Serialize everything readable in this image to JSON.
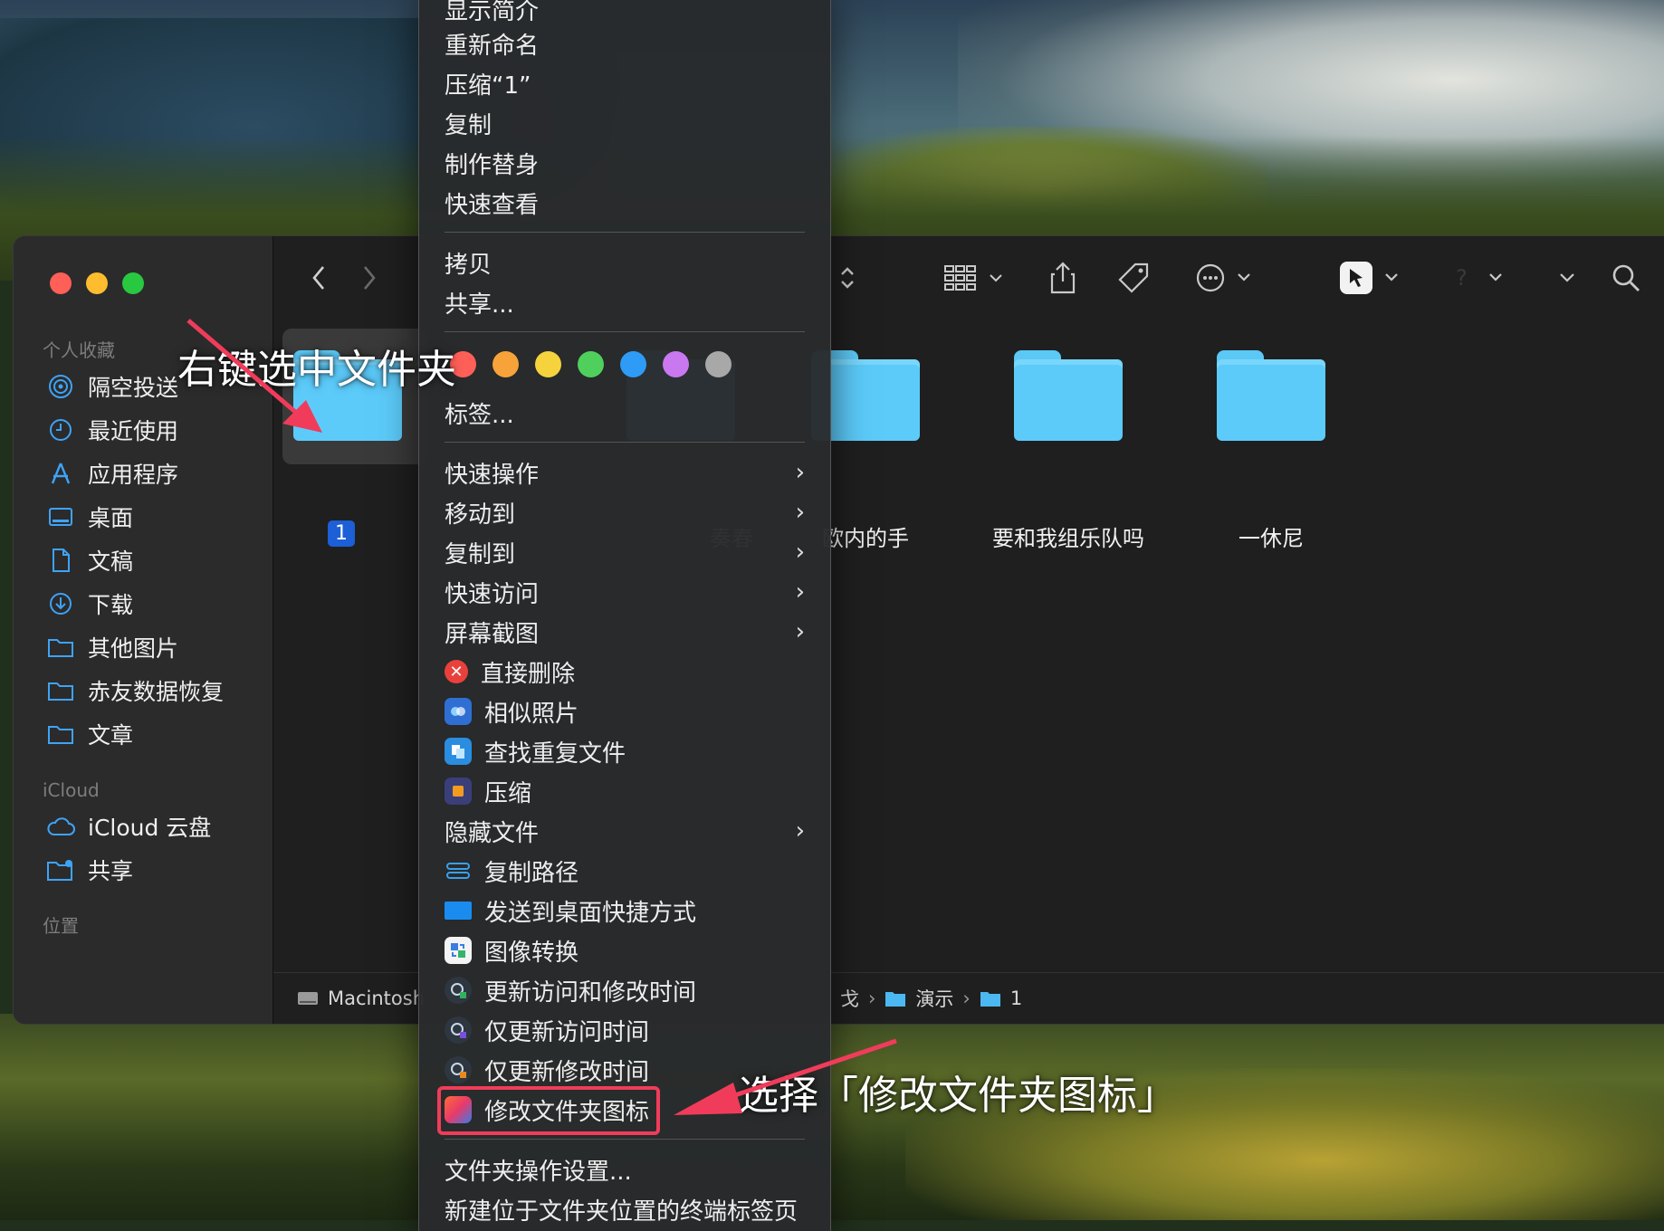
{
  "colors": {
    "accent_red": "#f03c5a",
    "folder_blue": "#5ccbfa",
    "selection_blue": "#1c5fd6"
  },
  "sidebar": {
    "favorites_heading": "个人收藏",
    "favorites": [
      {
        "label": "隔空投送",
        "icon": "airdrop-icon"
      },
      {
        "label": "最近使用",
        "icon": "clock-icon"
      },
      {
        "label": "应用程序",
        "icon": "applications-icon"
      },
      {
        "label": "桌面",
        "icon": "desktop-icon"
      },
      {
        "label": "文稿",
        "icon": "document-icon"
      },
      {
        "label": "下载",
        "icon": "download-icon"
      },
      {
        "label": "其他图片",
        "icon": "folder-icon"
      },
      {
        "label": "赤友数据恢复",
        "icon": "folder-icon"
      },
      {
        "label": "文章",
        "icon": "folder-icon"
      }
    ],
    "icloud_heading": "iCloud",
    "icloud": [
      {
        "label": "iCloud 云盘",
        "icon": "cloud-icon"
      },
      {
        "label": "共享",
        "icon": "shared-folder-icon"
      }
    ],
    "locations_heading": "位置"
  },
  "toolbar": {
    "back": "<",
    "forward": ">",
    "sort": "⌃⌄"
  },
  "folders": [
    {
      "label": "1",
      "selected": true
    },
    {
      "label": "奏春"
    },
    {
      "label": "欧内的手"
    },
    {
      "label": "要和我组乐队吗"
    },
    {
      "label": "一休尼"
    }
  ],
  "pathbar": {
    "disk": "Macintosh",
    "partial": "戈",
    "demo": "演示",
    "current": "1"
  },
  "menu": {
    "top_items": [
      "显示简介",
      "重新命名",
      "压缩“1”",
      "复制",
      "制作替身",
      "快速查看"
    ],
    "copy_items": [
      "拷贝",
      "共享..."
    ],
    "tag_colors": [
      "#fe5f57",
      "#f7a33a",
      "#f6d33c",
      "#4fd05c",
      "#2e9bf6",
      "#c978f0",
      "#a8a8a8"
    ],
    "tags_label": "标签...",
    "submenu_items": [
      "快速操作",
      "移动到",
      "复制到",
      "快速访问",
      "屏幕截图"
    ],
    "tool_items": [
      {
        "label": "直接删除",
        "icon": "delete-icon",
        "color": "#e8413c"
      },
      {
        "label": "相似照片",
        "icon": "photos-icon",
        "color": "#2f6fd3"
      },
      {
        "label": "查找重复文件",
        "icon": "duplicate-icon",
        "color": "#2a8de0"
      },
      {
        "label": "压缩",
        "icon": "compress-icon",
        "color": "#f29c1f"
      }
    ],
    "hidden_files": "隐藏文件",
    "tool_items_2": [
      {
        "label": "复制路径",
        "icon": "path-icon",
        "color": "#3aa0ef"
      },
      {
        "label": "发送到桌面快捷方式",
        "icon": "desktop-shortcut-icon",
        "color": "#1a8cf0"
      },
      {
        "label": "图像转换",
        "icon": "image-convert-icon",
        "color": "#3b7de0"
      },
      {
        "label": "更新访问和修改时间",
        "icon": "time-icon",
        "color": "#33b15a"
      },
      {
        "label": "仅更新访问时间",
        "icon": "time-icon",
        "color": "#7a4fe0"
      },
      {
        "label": "仅更新修改时间",
        "icon": "time-icon",
        "color": "#e88a20"
      },
      {
        "label": "修改文件夹图标",
        "icon": "folder-icon-change-icon",
        "color": "#e85a3a"
      }
    ],
    "bottom_items": [
      "文件夹操作设置...",
      "新建位于文件夹位置的终端标签页"
    ]
  },
  "annotations": {
    "right_click": "右键选中文件夹",
    "choose": "选择「修改文件夹图标」"
  }
}
